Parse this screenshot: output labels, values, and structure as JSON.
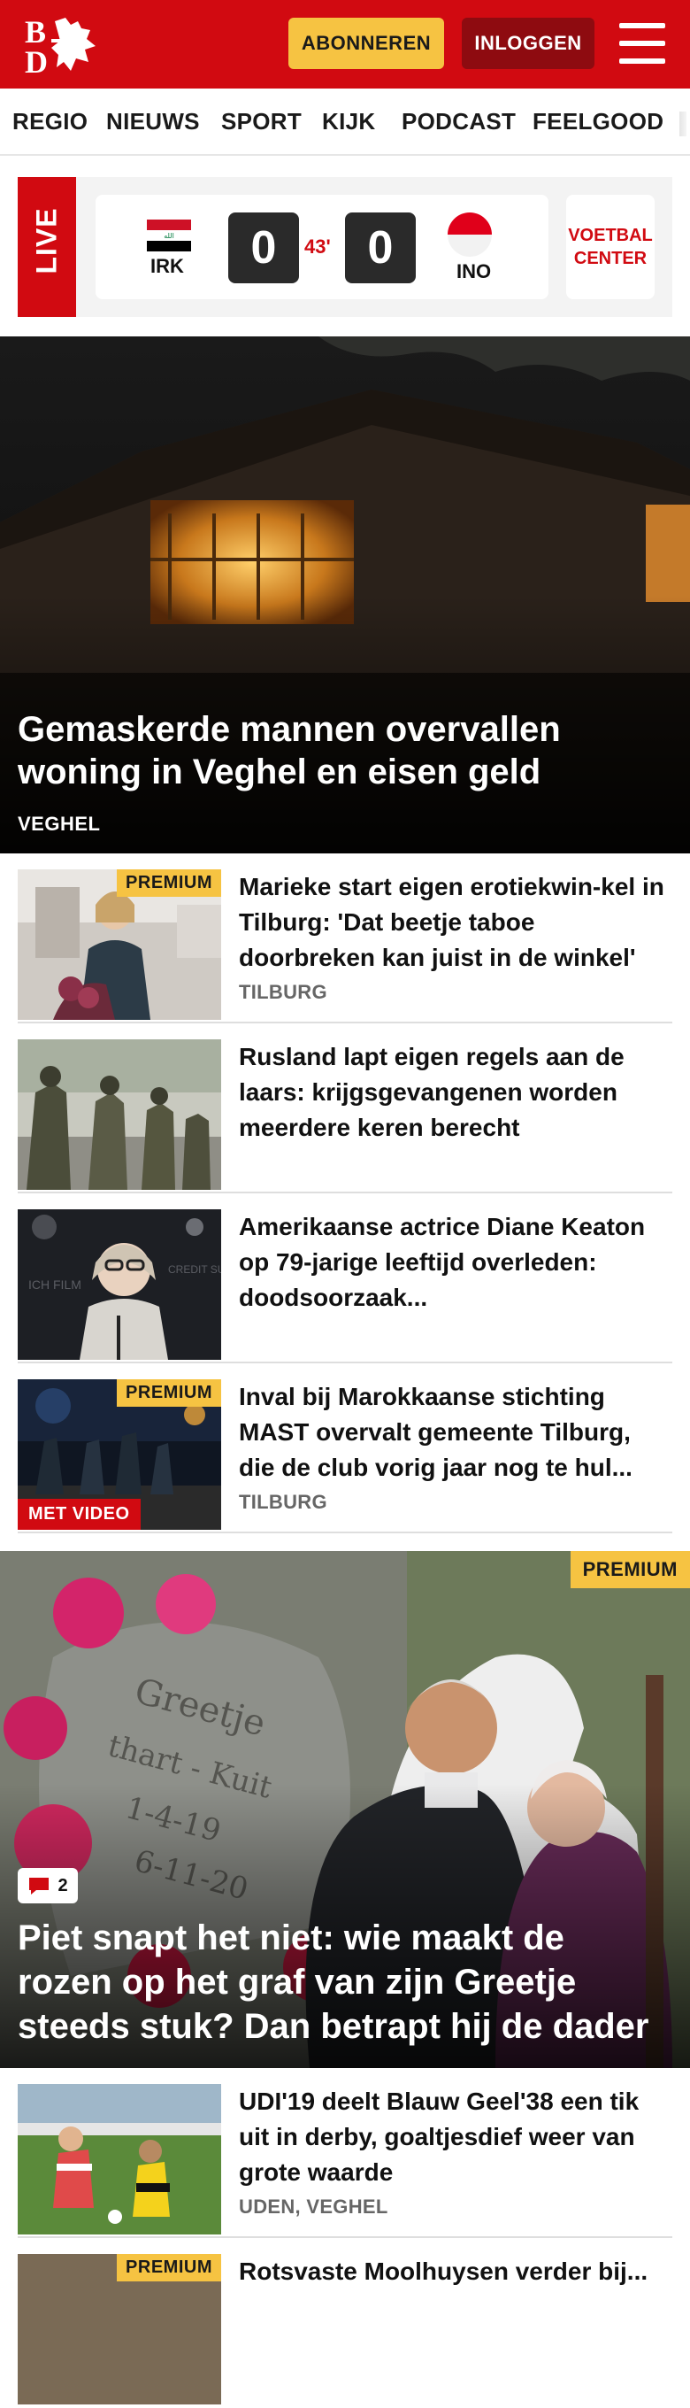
{
  "header": {
    "logo_text": "BD",
    "subscribe_label": "ABONNEREN",
    "login_label": "INLOGGEN"
  },
  "nav": {
    "items": [
      "REGIO",
      "NIEUWS",
      "SPORT",
      "KIJK",
      "PODCAST",
      "FEELGOOD"
    ]
  },
  "live": {
    "tag": "LIVE",
    "home_team": "IRK",
    "away_team": "INO",
    "home_score": "0",
    "away_score": "0",
    "minute": "43'",
    "center_label_1": "VOETBAL",
    "center_label_2": "CENTER"
  },
  "hero1": {
    "title_line1": "Gemaskerde mannen overvallen",
    "title_line2": "woning in Veghel en eisen geld",
    "kicker": "VEGHEL"
  },
  "articles": [
    {
      "title": "Marieke start eigen erotiekwin-kel in Tilburg: 'Dat beetje taboe doorbreken kan juist in de winkel'",
      "meta": "TILBURG",
      "premium": "PREMIUM"
    },
    {
      "title": "Rusland lapt eigen regels aan de laars: krijgsgevangenen worden meerdere keren berecht",
      "meta": ""
    },
    {
      "title": "Amerikaanse actrice Diane Keaton op 79-jarige leeftijd overleden: doodsoorzaak...",
      "meta": ""
    },
    {
      "title": "Inval bij Marokkaanse stichting MAST overvalt gemeente Tilburg, die de club vorig jaar nog te hul...",
      "meta": "TILBURG",
      "premium": "PREMIUM",
      "video": "MET VIDEO"
    }
  ],
  "hero2": {
    "premium": "PREMIUM",
    "comments": "2",
    "title_line1": "Piet snapt het niet: wie maakt de",
    "title_line2": "rozen op het graf van zijn Greetje",
    "title_line3": "steeds stuk? Dan betrapt hij de dader"
  },
  "article5": {
    "title": "UDI'19 deelt Blauw Geel'38 een tik uit in derby, goaltjesdief weer van grote waarde",
    "meta": "UDEN, VEGHEL"
  },
  "article6": {
    "premium": "PREMIUM",
    "title": "Rotsvaste Moolhuysen verder bij..."
  },
  "colors": {
    "brand_red": "#d10a11",
    "premium_yellow": "#f6c342",
    "login_dark_red": "#8e0b10"
  }
}
